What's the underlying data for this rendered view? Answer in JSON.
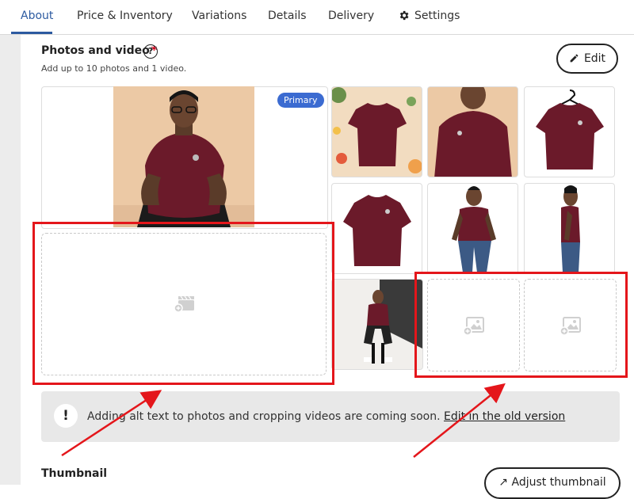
{
  "tabs": [
    {
      "label": "About",
      "active": true
    },
    {
      "label": "Price & Inventory"
    },
    {
      "label": "Variations"
    },
    {
      "label": "Details"
    },
    {
      "label": "Delivery"
    },
    {
      "label": "Settings",
      "icon": "gear-icon"
    }
  ],
  "photos": {
    "title": "Photos and video",
    "required_mark": "*",
    "help_symbol": "?",
    "subtitle": "Add up to 10 photos and 1 video.",
    "edit_label": "Edit",
    "primary_badge": "Primary"
  },
  "notice": {
    "icon_symbol": "!",
    "text": "Adding alt text to photos and cropping videos are coming soon.",
    "link": "Edit in the old version"
  },
  "thumbnail": {
    "title": "Thumbnail",
    "adjust_label": "Adjust thumbnail"
  },
  "colors": {
    "accent": "#2c5aa0",
    "shirt": "#6b1a2a",
    "annotation_red": "#e4161b",
    "primary_badge": "#3b6bd1"
  }
}
